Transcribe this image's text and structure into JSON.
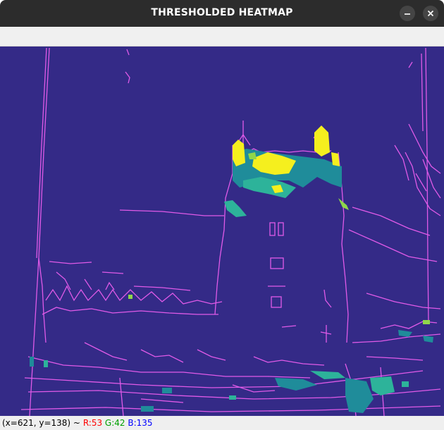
{
  "window": {
    "title": "THRESHOLDED HEATMAP",
    "minimize_icon": "minimize-icon",
    "close_icon": "close-icon"
  },
  "image": {
    "description_icon": "heatmap-image",
    "colors": {
      "background": "#342a87",
      "edges": "#e05ae8",
      "hot": "#f5ef1e",
      "warm": "#8fd64a",
      "mid": "#2db39a",
      "cool": "#1f8c9a"
    }
  },
  "status": {
    "coords": "(x=621, y=138) ~",
    "r": "R:53",
    "g": "G:42",
    "b": "B:135"
  }
}
